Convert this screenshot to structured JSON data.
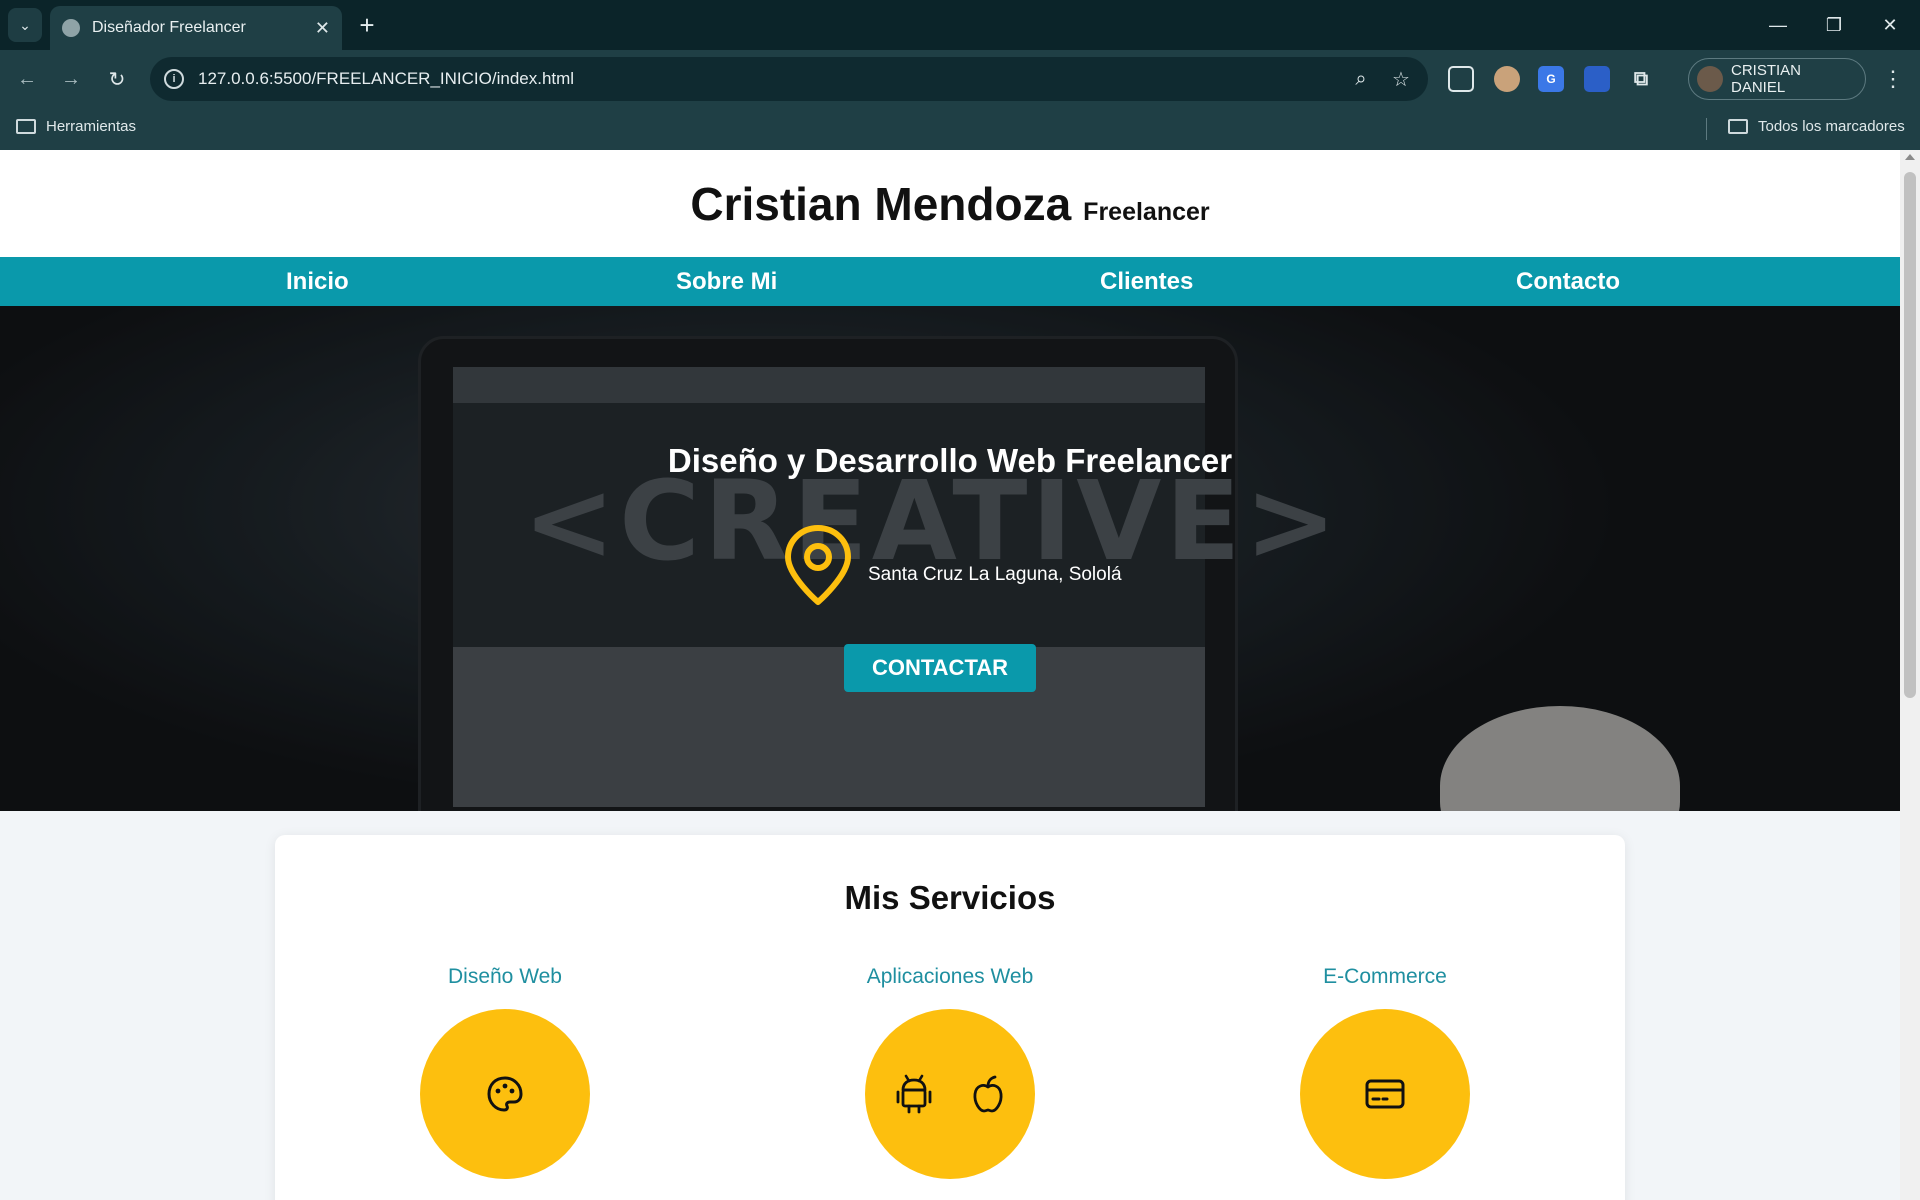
{
  "browser": {
    "tab_title": "Diseñador Freelancer",
    "url": "127.0.0.6:5500/FREELANCER_INICIO/index.html",
    "profile_name": "CRISTIAN DANIEL",
    "bookmarks": {
      "folder": "Herramientas",
      "all_bookmarks": "Todos los marcadores"
    }
  },
  "site": {
    "name": "Cristian Mendoza",
    "name_suffix": "Freelancer",
    "nav": [
      "Inicio",
      "Sobre Mi",
      "Clientes",
      "Contacto"
    ],
    "hero": {
      "title": "Diseño y Desarrollo Web Freelancer",
      "location": "Santa Cruz La Laguna, Sololá",
      "cta": "CONTACTAR"
    },
    "services": {
      "title": "Mis Servicios",
      "items": [
        {
          "label": "Diseño Web",
          "icon": "palette-icon"
        },
        {
          "label": "Aplicaciones Web",
          "icon": "android-icon, apple-icon"
        },
        {
          "label": "E-Commerce",
          "icon": "credit-card-icon"
        }
      ]
    }
  },
  "colors": {
    "accent": "#0a99ab",
    "yellow": "#fdbf0e"
  }
}
